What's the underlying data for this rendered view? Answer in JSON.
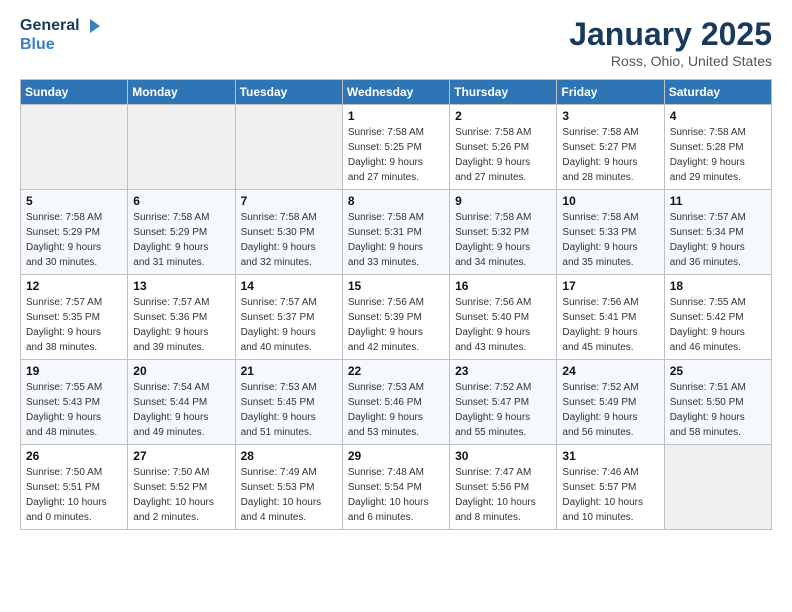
{
  "logo": {
    "line1": "General",
    "line2": "Blue"
  },
  "title": "January 2025",
  "location": "Ross, Ohio, United States",
  "weekdays": [
    "Sunday",
    "Monday",
    "Tuesday",
    "Wednesday",
    "Thursday",
    "Friday",
    "Saturday"
  ],
  "weeks": [
    [
      {
        "day": "",
        "detail": ""
      },
      {
        "day": "",
        "detail": ""
      },
      {
        "day": "",
        "detail": ""
      },
      {
        "day": "1",
        "detail": "Sunrise: 7:58 AM\nSunset: 5:25 PM\nDaylight: 9 hours\nand 27 minutes."
      },
      {
        "day": "2",
        "detail": "Sunrise: 7:58 AM\nSunset: 5:26 PM\nDaylight: 9 hours\nand 27 minutes."
      },
      {
        "day": "3",
        "detail": "Sunrise: 7:58 AM\nSunset: 5:27 PM\nDaylight: 9 hours\nand 28 minutes."
      },
      {
        "day": "4",
        "detail": "Sunrise: 7:58 AM\nSunset: 5:28 PM\nDaylight: 9 hours\nand 29 minutes."
      }
    ],
    [
      {
        "day": "5",
        "detail": "Sunrise: 7:58 AM\nSunset: 5:29 PM\nDaylight: 9 hours\nand 30 minutes."
      },
      {
        "day": "6",
        "detail": "Sunrise: 7:58 AM\nSunset: 5:29 PM\nDaylight: 9 hours\nand 31 minutes."
      },
      {
        "day": "7",
        "detail": "Sunrise: 7:58 AM\nSunset: 5:30 PM\nDaylight: 9 hours\nand 32 minutes."
      },
      {
        "day": "8",
        "detail": "Sunrise: 7:58 AM\nSunset: 5:31 PM\nDaylight: 9 hours\nand 33 minutes."
      },
      {
        "day": "9",
        "detail": "Sunrise: 7:58 AM\nSunset: 5:32 PM\nDaylight: 9 hours\nand 34 minutes."
      },
      {
        "day": "10",
        "detail": "Sunrise: 7:58 AM\nSunset: 5:33 PM\nDaylight: 9 hours\nand 35 minutes."
      },
      {
        "day": "11",
        "detail": "Sunrise: 7:57 AM\nSunset: 5:34 PM\nDaylight: 9 hours\nand 36 minutes."
      }
    ],
    [
      {
        "day": "12",
        "detail": "Sunrise: 7:57 AM\nSunset: 5:35 PM\nDaylight: 9 hours\nand 38 minutes."
      },
      {
        "day": "13",
        "detail": "Sunrise: 7:57 AM\nSunset: 5:36 PM\nDaylight: 9 hours\nand 39 minutes."
      },
      {
        "day": "14",
        "detail": "Sunrise: 7:57 AM\nSunset: 5:37 PM\nDaylight: 9 hours\nand 40 minutes."
      },
      {
        "day": "15",
        "detail": "Sunrise: 7:56 AM\nSunset: 5:39 PM\nDaylight: 9 hours\nand 42 minutes."
      },
      {
        "day": "16",
        "detail": "Sunrise: 7:56 AM\nSunset: 5:40 PM\nDaylight: 9 hours\nand 43 minutes."
      },
      {
        "day": "17",
        "detail": "Sunrise: 7:56 AM\nSunset: 5:41 PM\nDaylight: 9 hours\nand 45 minutes."
      },
      {
        "day": "18",
        "detail": "Sunrise: 7:55 AM\nSunset: 5:42 PM\nDaylight: 9 hours\nand 46 minutes."
      }
    ],
    [
      {
        "day": "19",
        "detail": "Sunrise: 7:55 AM\nSunset: 5:43 PM\nDaylight: 9 hours\nand 48 minutes."
      },
      {
        "day": "20",
        "detail": "Sunrise: 7:54 AM\nSunset: 5:44 PM\nDaylight: 9 hours\nand 49 minutes."
      },
      {
        "day": "21",
        "detail": "Sunrise: 7:53 AM\nSunset: 5:45 PM\nDaylight: 9 hours\nand 51 minutes."
      },
      {
        "day": "22",
        "detail": "Sunrise: 7:53 AM\nSunset: 5:46 PM\nDaylight: 9 hours\nand 53 minutes."
      },
      {
        "day": "23",
        "detail": "Sunrise: 7:52 AM\nSunset: 5:47 PM\nDaylight: 9 hours\nand 55 minutes."
      },
      {
        "day": "24",
        "detail": "Sunrise: 7:52 AM\nSunset: 5:49 PM\nDaylight: 9 hours\nand 56 minutes."
      },
      {
        "day": "25",
        "detail": "Sunrise: 7:51 AM\nSunset: 5:50 PM\nDaylight: 9 hours\nand 58 minutes."
      }
    ],
    [
      {
        "day": "26",
        "detail": "Sunrise: 7:50 AM\nSunset: 5:51 PM\nDaylight: 10 hours\nand 0 minutes."
      },
      {
        "day": "27",
        "detail": "Sunrise: 7:50 AM\nSunset: 5:52 PM\nDaylight: 10 hours\nand 2 minutes."
      },
      {
        "day": "28",
        "detail": "Sunrise: 7:49 AM\nSunset: 5:53 PM\nDaylight: 10 hours\nand 4 minutes."
      },
      {
        "day": "29",
        "detail": "Sunrise: 7:48 AM\nSunset: 5:54 PM\nDaylight: 10 hours\nand 6 minutes."
      },
      {
        "day": "30",
        "detail": "Sunrise: 7:47 AM\nSunset: 5:56 PM\nDaylight: 10 hours\nand 8 minutes."
      },
      {
        "day": "31",
        "detail": "Sunrise: 7:46 AM\nSunset: 5:57 PM\nDaylight: 10 hours\nand 10 minutes."
      },
      {
        "day": "",
        "detail": ""
      }
    ]
  ]
}
